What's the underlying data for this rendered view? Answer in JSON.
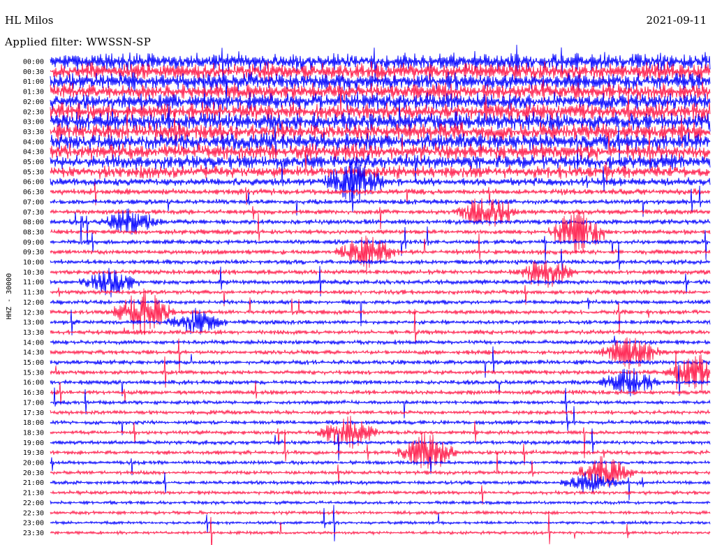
{
  "header": {
    "station": "HL Milos",
    "date": "2021-09-11",
    "filter_label": "Applied filter: WWSSN-SP"
  },
  "chart_data": {
    "type": "helicorder",
    "title": "HL Milos",
    "date": "2021-09-11",
    "filter": "WWSSN-SP",
    "channel_label": "HHZ - 30000",
    "row_labels": [
      "00:00",
      "00:30",
      "01:00",
      "01:30",
      "02:00",
      "02:30",
      "03:00",
      "03:30",
      "04:00",
      "04:30",
      "05:00",
      "05:30",
      "06:00",
      "06:30",
      "07:00",
      "07:30",
      "08:00",
      "08:30",
      "09:00",
      "09:30",
      "10:00",
      "10:30",
      "11:00",
      "11:30",
      "12:00",
      "12:30",
      "13:00",
      "13:30",
      "14:00",
      "14:30",
      "15:00",
      "15:30",
      "16:00",
      "16:30",
      "17:00",
      "17:30",
      "18:00",
      "18:30",
      "19:00",
      "19:30",
      "20:00",
      "20:30",
      "21:00",
      "21:30",
      "22:00",
      "22:30",
      "23:00",
      "23:30"
    ],
    "colors": [
      "#0000ff",
      "#ff1a4a"
    ],
    "background_noise": [
      1.0,
      1.0,
      0.95,
      0.95,
      0.95,
      1.0,
      1.0,
      1.0,
      0.95,
      0.9,
      0.8,
      0.7,
      0.45,
      0.35,
      0.3,
      0.3,
      0.3,
      0.28,
      0.28,
      0.28,
      0.28,
      0.28,
      0.28,
      0.26,
      0.26,
      0.26,
      0.26,
      0.26,
      0.26,
      0.26,
      0.26,
      0.26,
      0.26,
      0.26,
      0.24,
      0.24,
      0.24,
      0.24,
      0.24,
      0.24,
      0.22,
      0.22,
      0.22,
      0.22,
      0.2,
      0.2,
      0.18,
      0.18
    ],
    "events": [
      {
        "time": "06:00",
        "position": 0.46,
        "amplitude": 1.4
      },
      {
        "time": "07:30",
        "position": 0.66,
        "amplitude": 1.3
      },
      {
        "time": "08:00",
        "position": 0.12,
        "amplitude": 0.9
      },
      {
        "time": "08:30",
        "position": 0.8,
        "amplitude": 1.6
      },
      {
        "time": "09:30",
        "position": 0.48,
        "amplitude": 1.1
      },
      {
        "time": "10:30",
        "position": 0.75,
        "amplitude": 1.1
      },
      {
        "time": "11:00",
        "position": 0.09,
        "amplitude": 0.9
      },
      {
        "time": "12:30",
        "position": 0.14,
        "amplitude": 1.6
      },
      {
        "time": "13:00",
        "position": 0.22,
        "amplitude": 0.8
      },
      {
        "time": "14:30",
        "position": 0.88,
        "amplitude": 1.1
      },
      {
        "time": "15:30",
        "position": 0.98,
        "amplitude": 1.2
      },
      {
        "time": "16:00",
        "position": 0.88,
        "amplitude": 0.9
      },
      {
        "time": "18:30",
        "position": 0.45,
        "amplitude": 1.2
      },
      {
        "time": "19:30",
        "position": 0.57,
        "amplitude": 1.5
      },
      {
        "time": "20:30",
        "position": 0.84,
        "amplitude": 1.1
      },
      {
        "time": "21:00",
        "position": 0.82,
        "amplitude": 0.7
      }
    ]
  }
}
